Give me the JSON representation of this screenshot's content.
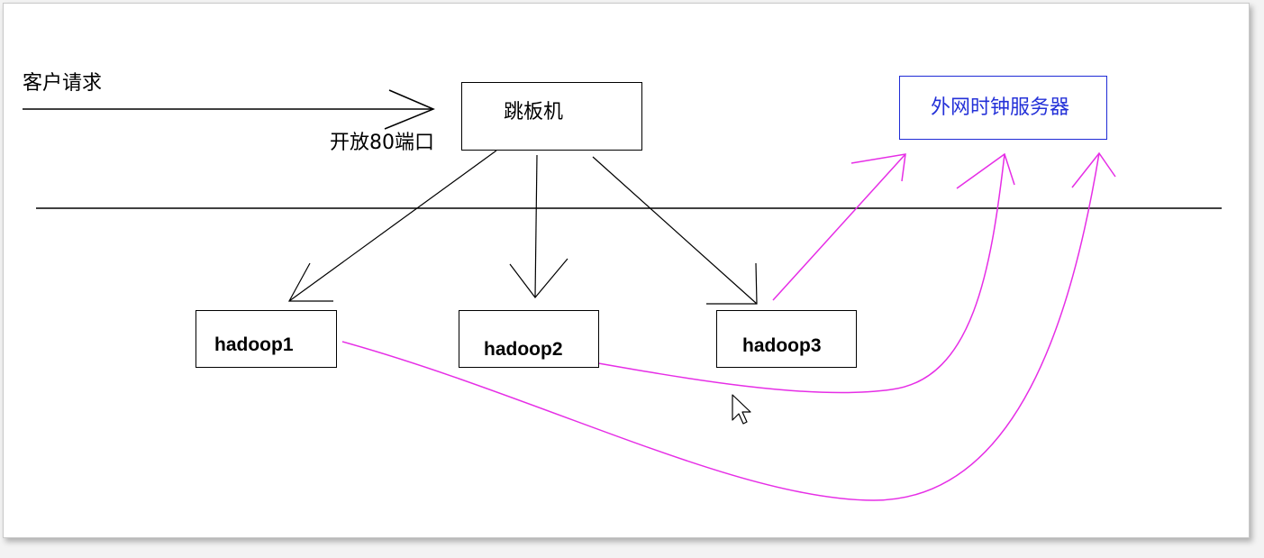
{
  "labels": {
    "client_request": "客户请求",
    "open_port": "开放80端口"
  },
  "nodes": {
    "jump_host": "跳板机",
    "ntp_server": "外网时钟服务器",
    "hadoop1": "hadoop1",
    "hadoop2": "hadoop2",
    "hadoop3": "hadoop3"
  },
  "colors": {
    "line": "#000000",
    "sync_arrow": "#e62ee6",
    "ntp_border": "#1f2bd6",
    "ntp_text": "#2431d8"
  }
}
